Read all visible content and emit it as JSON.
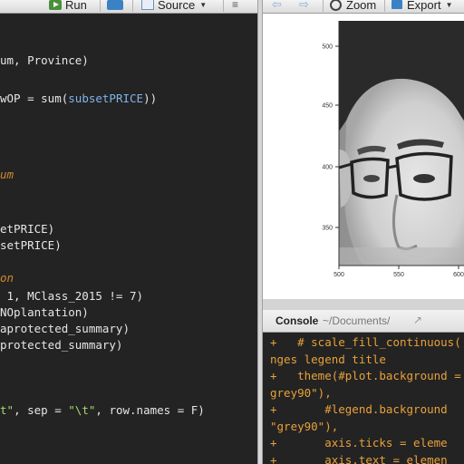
{
  "editor": {
    "toolbar": {
      "run_label": "Run",
      "source_label": "Source"
    },
    "lines": [
      {
        "top": 58,
        "segments": [
          {
            "text": "um, Province)",
            "cls": "c-id"
          }
        ]
      },
      {
        "top": 100,
        "segments": [
          {
            "text": "wOP = sum(",
            "cls": "c-id"
          },
          {
            "text": "subsetPRICE",
            "cls": "c-kw"
          },
          {
            "text": "))",
            "cls": "c-id"
          }
        ]
      },
      {
        "top": 184,
        "segments": [
          {
            "text": "um",
            "cls": "c-cmt"
          }
        ]
      },
      {
        "top": 244,
        "segments": [
          {
            "text": "etPRICE)",
            "cls": "c-id"
          }
        ]
      },
      {
        "top": 262,
        "segments": [
          {
            "text": "setPRICE)",
            "cls": "c-id"
          }
        ]
      },
      {
        "top": 298,
        "segments": [
          {
            "text": "on",
            "cls": "c-cmt"
          }
        ]
      },
      {
        "top": 318,
        "segments": [
          {
            "text": " 1, MClass_2015 != 7)",
            "cls": "c-id"
          }
        ]
      },
      {
        "top": 336,
        "segments": [
          {
            "text": "NOplantation)",
            "cls": "c-id"
          }
        ]
      },
      {
        "top": 354,
        "segments": [
          {
            "text": "aprotected_summary)",
            "cls": "c-id"
          }
        ]
      },
      {
        "top": 372,
        "segments": [
          {
            "text": "protected_summary)",
            "cls": "c-id"
          }
        ]
      },
      {
        "top": 444,
        "segments": [
          {
            "text": "t\"",
            "cls": "c-str"
          },
          {
            "text": ", sep = ",
            "cls": "c-id"
          },
          {
            "text": "\"\\t\"",
            "cls": "c-str"
          },
          {
            "text": ", row.names = F)",
            "cls": "c-id"
          }
        ]
      }
    ]
  },
  "plots": {
    "toolbar": {
      "zoom_label": "Zoom",
      "export_label": "Export"
    },
    "y_ticks": [
      "500",
      "450",
      "400",
      "350"
    ],
    "x_ticks": [
      "500",
      "550",
      "600"
    ],
    "image_description_icon": "grayscale-face-raster"
  },
  "console": {
    "title": "Console",
    "path": "~/Documents/",
    "lines": [
      "+   # scale_fill_continuous(",
      "nges legend title",
      "+   theme(#plot.background =",
      "grey90\"),",
      "+       #legend.background",
      "\"grey90\"),",
      "+       axis.ticks = eleme",
      "+       axis.text = elemen"
    ]
  },
  "colors": {
    "editor_bg": "#232323",
    "console_text": "#e8a13a",
    "comment": "#cc8a2e"
  }
}
